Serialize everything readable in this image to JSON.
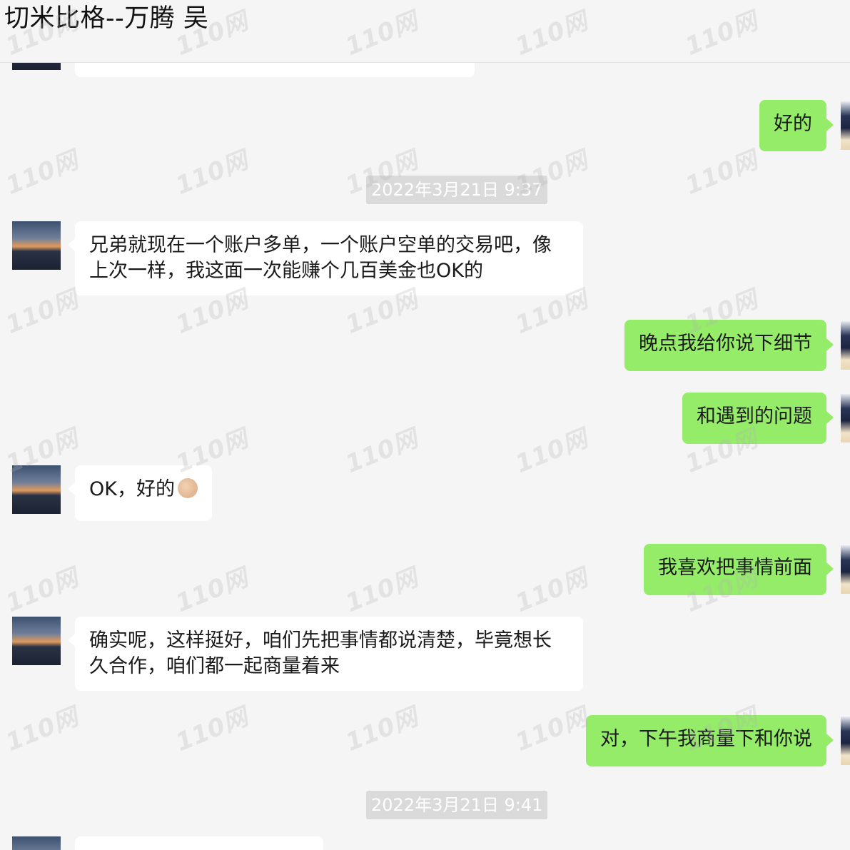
{
  "window": {
    "title": "切米比格--万腾  吴"
  },
  "messages": [
    {
      "side": "left",
      "text": ""
    },
    {
      "side": "right",
      "text": "好的"
    },
    {
      "type": "time",
      "text": "2022年3月21日 9:37"
    },
    {
      "side": "left",
      "text": "兄弟就现在一个账户多单，一个账户空单的交易吧，像上次一样，我这面一次能赚个几百美金也OK的"
    },
    {
      "side": "right",
      "text": "晚点我给你说下细节"
    },
    {
      "side": "right",
      "text": "和遇到的问题"
    },
    {
      "side": "left",
      "text": "OK，好的",
      "emoji": "ok-hand-icon"
    },
    {
      "side": "right",
      "text": "我喜欢把事情前面"
    },
    {
      "side": "left",
      "text": "确实呢，这样挺好，咱们先把事情都说清楚，毕竟想长久合作，咱们都一起商量着来"
    },
    {
      "side": "right",
      "text": "对，下午我商量下和你说"
    },
    {
      "type": "time",
      "text": "2022年3月21日 9:41"
    },
    {
      "side": "left",
      "text": ""
    }
  ],
  "watermark": {
    "text": "110网"
  },
  "colors": {
    "sent_bubble": "#95ec69",
    "received_bubble": "#ffffff",
    "background": "#f5f5f5"
  }
}
